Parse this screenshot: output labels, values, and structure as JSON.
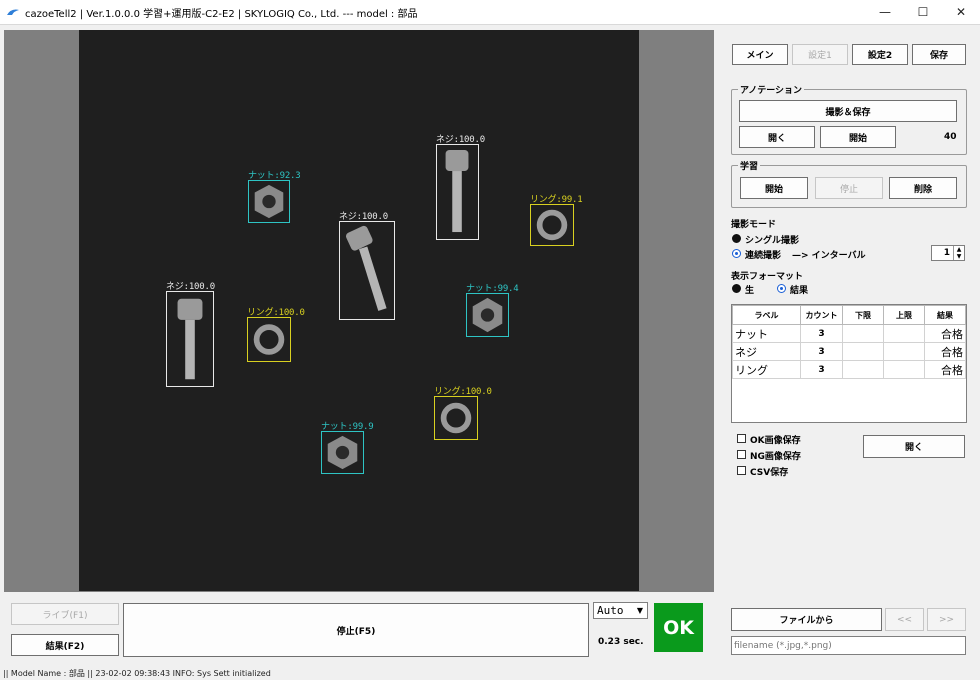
{
  "window": {
    "title": "cazoeTell2 | Ver.1.0.0.0 学習+運用版-C2-E2 | SKYLOGIQ Co., Ltd. --- model : 部品",
    "minimize": "—",
    "maximize": "☐",
    "close": "✕"
  },
  "detections": [
    {
      "class": "nut",
      "label": "ナット:92.3"
    },
    {
      "class": "screw",
      "label": "ネジ:100.0"
    },
    {
      "class": "screw",
      "label": "ネジ:100.0"
    },
    {
      "class": "ring",
      "label": "リング:99.1"
    },
    {
      "class": "screw",
      "label": "ネジ:100.0"
    },
    {
      "class": "nut",
      "label": "ナット:99.4"
    },
    {
      "class": "ring",
      "label": "リング:100.0"
    },
    {
      "class": "ring",
      "label": "リング:100.0"
    },
    {
      "class": "nut",
      "label": "ナット:99.9"
    }
  ],
  "top_tabs": {
    "main": "メイン",
    "settings1": "設定1",
    "settings2": "設定2",
    "save": "保存"
  },
  "annotation": {
    "title": "アノテーション",
    "capture_save": "撮影＆保存",
    "open": "開く",
    "start": "開始",
    "count": "40"
  },
  "learning": {
    "title": "学習",
    "start": "開始",
    "stop": "停止",
    "delete": "削除"
  },
  "capture_mode": {
    "title": "撮影モード",
    "single": "シングル撮影",
    "continuous": "連続撮影",
    "interval": "—> インターバル",
    "interval_value": "1"
  },
  "display_format": {
    "title": "表示フォーマット",
    "raw": "生",
    "result": "結果"
  },
  "result_table": {
    "headers": [
      "ラベル",
      "カウント",
      "下限",
      "上限",
      "結果"
    ],
    "rows": [
      {
        "label": "ナット",
        "count": "3",
        "lower": "",
        "upper": "",
        "result": "合格"
      },
      {
        "label": "ネジ",
        "count": "3",
        "lower": "",
        "upper": "",
        "result": "合格"
      },
      {
        "label": "リング",
        "count": "3",
        "lower": "",
        "upper": "",
        "result": "合格"
      }
    ]
  },
  "options": {
    "ok_image_save": "OK画像保存",
    "ng_image_save": "NG画像保存",
    "csv_save": "CSV保存",
    "open": "開く"
  },
  "bottom": {
    "live": "ライブ(F1)",
    "result": "結果(F2)",
    "stop": "停止(F5)",
    "mode": "Auto",
    "time": "0.23 sec.",
    "verdict": "OK",
    "from_file": "ファイルから",
    "prev": "<<",
    "next": ">>",
    "filename_placeholder": "filename (*.jpg,*.png)"
  },
  "status": "|| Model Name : 部品 ||    23-02-02 09:38:43   INFO:   Sys Sett initialized",
  "colors": {
    "nut": "#2ec4c4",
    "screw": "#e8e8e8",
    "ring": "#d8d020",
    "ok_bg": "#0a9a1c"
  }
}
